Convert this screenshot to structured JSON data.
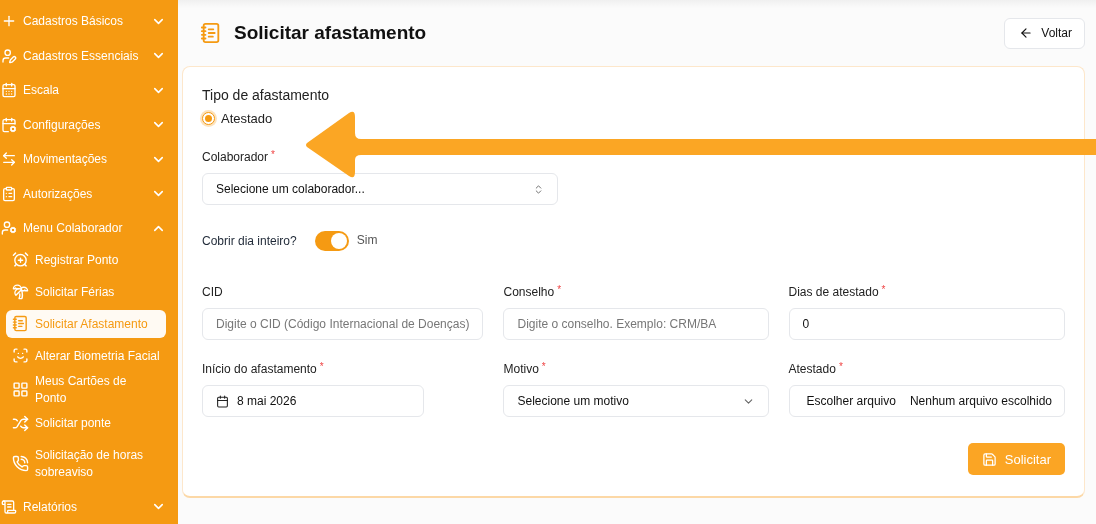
{
  "sidebar": {
    "items": [
      {
        "label": "Cadastros Básicos",
        "expanded": false
      },
      {
        "label": "Cadastros Essenciais",
        "expanded": false
      },
      {
        "label": "Escala",
        "expanded": false
      },
      {
        "label": "Configurações",
        "expanded": false
      },
      {
        "label": "Movimentações",
        "expanded": false
      },
      {
        "label": "Autorizações",
        "expanded": false
      },
      {
        "label": "Menu Colaborador",
        "expanded": true,
        "children": [
          {
            "label": "Registrar Ponto",
            "selected": false
          },
          {
            "label": "Solicitar Férias",
            "selected": false
          },
          {
            "label": "Solicitar Afastamento",
            "selected": true
          },
          {
            "label": "Alterar Biometria Facial",
            "selected": false
          },
          {
            "label": "Meus Cartões de Ponto",
            "selected": false
          },
          {
            "label": "Solicitar ponte",
            "selected": false
          },
          {
            "label": "Solicitação de horas sobreaviso",
            "selected": false
          }
        ]
      },
      {
        "label": "Relatórios",
        "expanded": false
      }
    ]
  },
  "header": {
    "title": "Solicitar afastamento",
    "back_button": "Voltar"
  },
  "form": {
    "type_label": "Tipo de afastamento",
    "type_options": [
      {
        "label": "Atestado",
        "selected": true
      }
    ],
    "collaborator": {
      "label": "Colaborador",
      "mark": "*",
      "value": "Selecione um colaborador..."
    },
    "full_day": {
      "label": "Cobrir dia inteiro?",
      "on": true,
      "state_label": "Sim"
    },
    "fields": [
      {
        "kind": "text",
        "label": "CID",
        "placeholder": "Digite o CID (Código Internacional de Doenças)"
      },
      {
        "kind": "text",
        "label": "Conselho",
        "mark": "*",
        "placeholder": "Digite o conselho. Exemplo: CRM/BA"
      },
      {
        "kind": "text",
        "label": "Dias de atestado",
        "mark": "*",
        "value": "0"
      },
      {
        "kind": "date",
        "label": "Início do afastamento",
        "mark": "*",
        "value": "8 mai 2026"
      },
      {
        "kind": "select",
        "label": "Motivo",
        "mark": "*",
        "value": "Selecione um motivo"
      },
      {
        "kind": "file",
        "label": "Atestado",
        "mark": "*",
        "button": "Escolher arquivo",
        "status": "Nenhum arquivo escolhido"
      }
    ],
    "submit": "Solicitar"
  }
}
